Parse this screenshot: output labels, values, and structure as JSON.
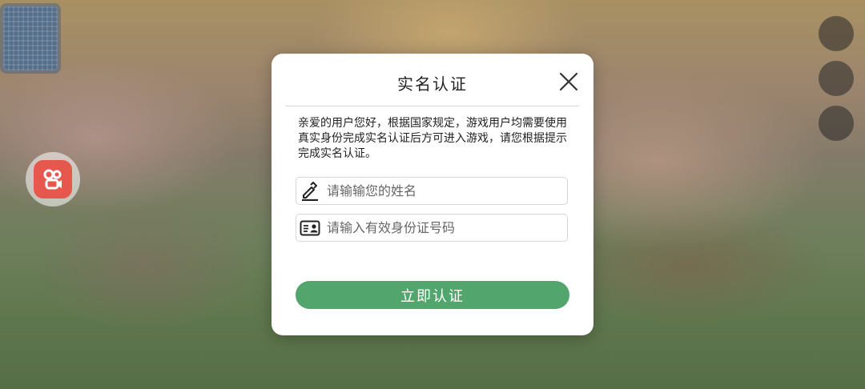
{
  "dialog": {
    "title": "实名认证",
    "description": "亲爱的用户您好，根据国家规定，游戏用户均需要使用真实身份完成实名认证后方可进入游戏，请您根据提示完成实名认证。",
    "name_field": {
      "placeholder": "请输输您的姓名",
      "value": ""
    },
    "id_field": {
      "placeholder": "请输入有效身份证号码",
      "value": ""
    },
    "submit_label": "立即认证",
    "icons": {
      "close": "close-icon",
      "name": "pencil-icon",
      "id": "id-card-icon"
    }
  },
  "floating_button": {
    "icon": "kuaishou-app-icon",
    "color": "#e6584e"
  },
  "colors": {
    "accent": "#52a66d",
    "dialog_bg": "#ffffff"
  }
}
